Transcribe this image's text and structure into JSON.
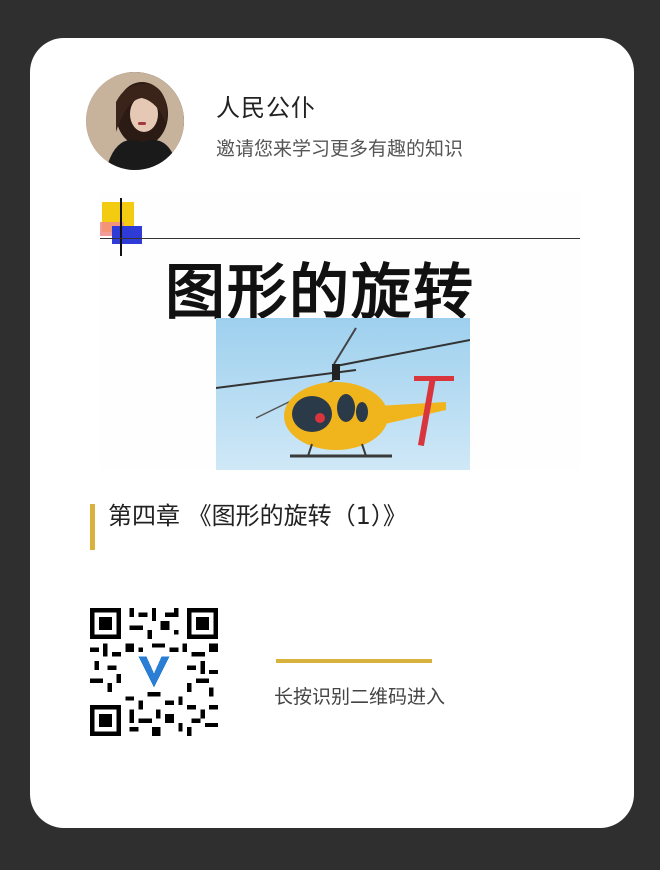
{
  "author": {
    "name": "人民公仆",
    "subtitle": "邀请您来学习更多有趣的知识",
    "avatar_icon": "user-avatar-icon"
  },
  "banner": {
    "title": "图形的旋转",
    "image_icon": "helicopter-image-icon"
  },
  "chapter": {
    "title": "第四章 《图形的旋转（1）》"
  },
  "share": {
    "qr_icon": "qr-code-icon",
    "hint": "长按识别二维码进入"
  },
  "colors": {
    "background": "#2f2f2f",
    "card": "#ffffff",
    "accent": "#d9b23d"
  }
}
